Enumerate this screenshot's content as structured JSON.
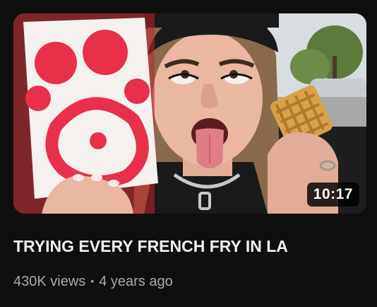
{
  "video": {
    "title": "TRYING EVERY FRENCH FRY IN LA",
    "duration": "10:17",
    "views": "430K views",
    "separator": "•",
    "age": "4 years ago"
  },
  "thumbnail": {
    "description_icon": "video-thumbnail-image",
    "colors": {
      "bag_red": "#e8304a",
      "bag_white": "#f4f1ef",
      "hat": "#1a1a1a",
      "hair": "#8a6a4c",
      "skin": "#e9b7a2",
      "fry": "#d9a24a",
      "sky": "#d7dde0",
      "trees": "#5c7a3c"
    }
  },
  "theme": {
    "background": "#0f0f0f",
    "title_color": "#f1f1f1",
    "meta_color": "#aaaaaa"
  }
}
